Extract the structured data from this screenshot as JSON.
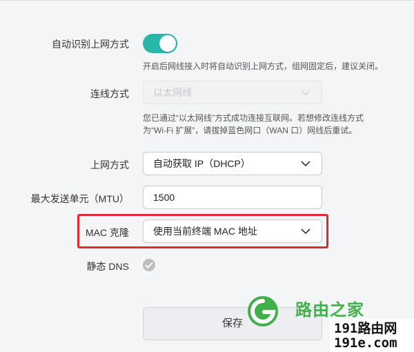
{
  "auto_detect": {
    "label": "自动识别上网方式",
    "enabled": true,
    "hint": "开启后网线接入时将自动识别上网方式，组网固定后，建议关闭。"
  },
  "connection_type": {
    "label": "连线方式",
    "value": "以太网线",
    "hint_line1": "您已通过“以太网线”方式成功连接互联网。若想修改连线方式",
    "hint_line2": "为“Wi-Fi 扩展”，请拔掉蓝色网口（WAN 口）网线后重试。"
  },
  "internet_mode": {
    "label": "上网方式",
    "value": "自动获取 IP（DHCP）"
  },
  "mtu": {
    "label": "最大发送单元（MTU）",
    "value": "1500"
  },
  "mac_clone": {
    "label": "MAC 克隆",
    "value": "使用当前终端 MAC 地址"
  },
  "static_dns": {
    "label": "静态 DNS",
    "checked": true
  },
  "save_button": {
    "label": "保存"
  },
  "watermark": {
    "line1": "路由之家",
    "line2": "191路由网",
    "line3": "191e.com"
  },
  "colors": {
    "toggle_on": "#2ab7a9",
    "highlight_box": "#e0282e",
    "watermark_green": "#3fb04a"
  }
}
